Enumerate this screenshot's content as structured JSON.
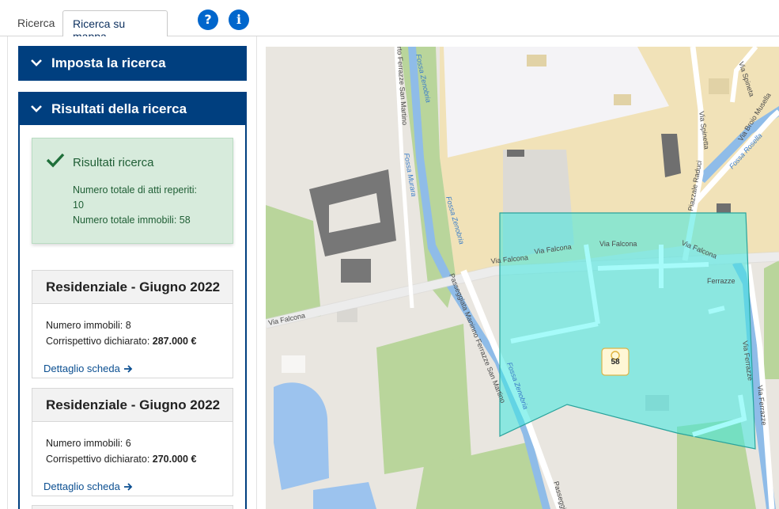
{
  "tabs": [
    {
      "label": "Ricerca"
    },
    {
      "label": "Ricerca su mappa"
    }
  ],
  "icons": {
    "help": "question-mark-icon",
    "info": "info-icon",
    "accent": "#0066cc"
  },
  "accordion": {
    "search_settings": "Imposta la ricerca",
    "results": "Risultati della ricerca"
  },
  "results_summary": {
    "title": "Risultati ricerca",
    "line1": "Numero totale di atti reperiti:",
    "line2": "10",
    "line3": "Numero totale immobili: 58"
  },
  "cards": [
    {
      "title": "Residenziale - Giugno 2022",
      "count_line": "Numero immobili: 8",
      "price_label": "Corrispettivo dichiarato: ",
      "price_value": "287.000 €",
      "link": "Dettaglio scheda"
    },
    {
      "title": "Residenziale - Giugno 2022",
      "count_line": "Numero immobili: 6",
      "price_label": "Corrispettivo dichiarato: ",
      "price_value": "270.000 €",
      "link": "Dettaglio scheda"
    }
  ],
  "map": {
    "cluster_count": "58",
    "street_labels": {
      "via_falcona": "Via Falcona",
      "ferrazze": "Ferrazze",
      "via_spinetta": "Via Spinetta",
      "piazzale_raduci": "Piazzale Raduci",
      "via_broio_musella": "Via Broio Musella",
      "fossa_rosella": "Fossa Rosella",
      "via_ferrazze": "Via Ferrazze",
      "fossa_zenobria": "Fossa Zenobria",
      "fossa_murara": "Fossa Murara",
      "passeggiata": "Passeggiata Maninno Ferrazze San Martino",
      "ferrazze_san_martino": "rto Ferrazze San Martino",
      "passeggi": "Passeggi",
      "via_spinetta_top": "Via Spineta"
    }
  }
}
